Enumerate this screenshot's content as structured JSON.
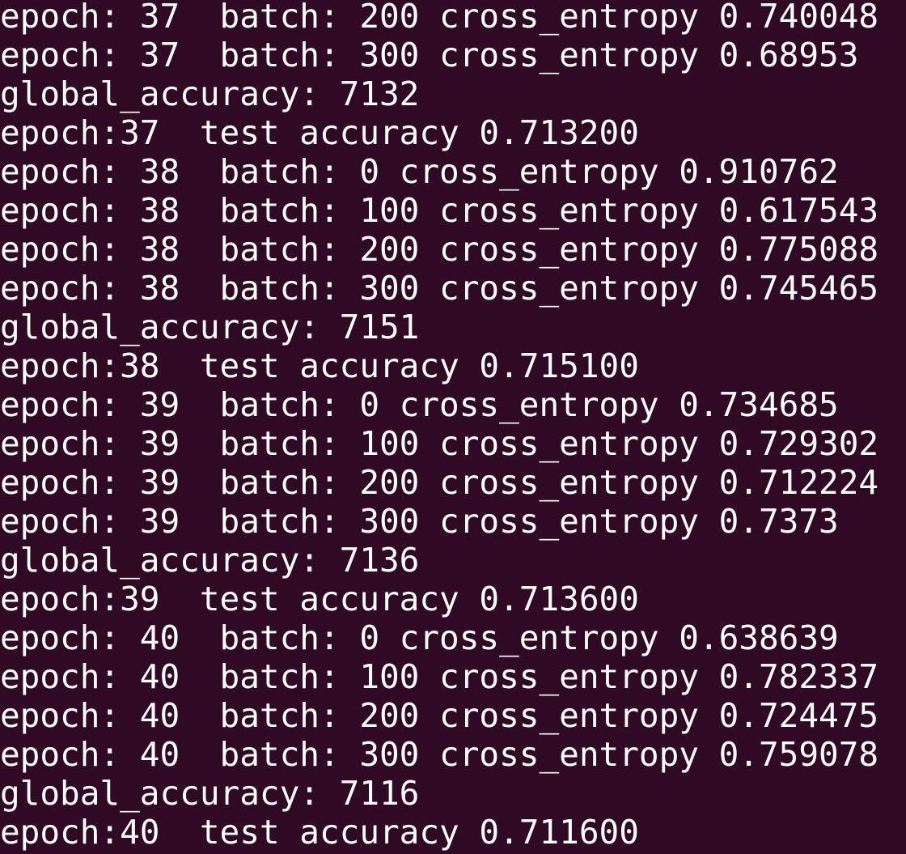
{
  "terminal": {
    "background": "#300a24",
    "foreground": "#ffffff",
    "lines": [
      "epoch: 37  batch: 200 cross_entropy 0.740048",
      "epoch: 37  batch: 300 cross_entropy 0.68953",
      "global_accuracy: 7132",
      "epoch:37  test accuracy 0.713200",
      "epoch: 38  batch: 0 cross_entropy 0.910762",
      "epoch: 38  batch: 100 cross_entropy 0.617543",
      "epoch: 38  batch: 200 cross_entropy 0.775088",
      "epoch: 38  batch: 300 cross_entropy 0.745465",
      "global_accuracy: 7151",
      "epoch:38  test accuracy 0.715100",
      "epoch: 39  batch: 0 cross_entropy 0.734685",
      "epoch: 39  batch: 100 cross_entropy 0.729302",
      "epoch: 39  batch: 200 cross_entropy 0.712224",
      "epoch: 39  batch: 300 cross_entropy 0.7373",
      "global_accuracy: 7136",
      "epoch:39  test accuracy 0.713600",
      "epoch: 40  batch: 0 cross_entropy 0.638639",
      "epoch: 40  batch: 100 cross_entropy 0.782337",
      "epoch: 40  batch: 200 cross_entropy 0.724475",
      "epoch: 40  batch: 300 cross_entropy 0.759078",
      "global_accuracy: 7116",
      "epoch:40  test accuracy 0.711600"
    ]
  }
}
